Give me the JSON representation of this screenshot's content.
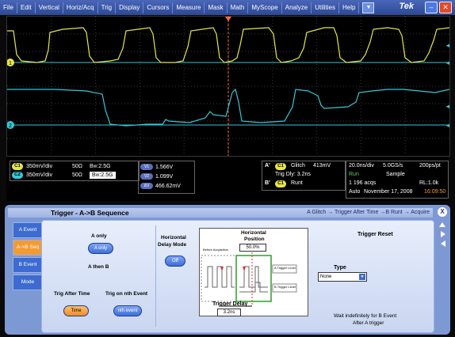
{
  "menu": [
    "File",
    "Edit",
    "Vertical",
    "Horiz/Acq",
    "Trig",
    "Display",
    "Cursors",
    "Measure",
    "Mask",
    "Math",
    "MyScope",
    "Analyze",
    "Utilities",
    "Help"
  ],
  "brand": "Tek",
  "window": {
    "minimize_icon": "minimize-icon",
    "close_icon": "close-icon"
  },
  "markers": {
    "ch1": "1",
    "ch2": "2",
    "trigger_arrow": "◄"
  },
  "channels": [
    {
      "tag": "C1",
      "scale": "350mV/div",
      "impedance": "50Ω",
      "bw": "B",
      "bw_sub": "W",
      "bw_val": ":2.5G",
      "color": "#e6e64a"
    },
    {
      "tag": "C2",
      "scale": "350mV/div",
      "impedance": "50Ω",
      "bw": "B",
      "bw_sub": "W",
      "bw_val": ":2.5G",
      "color": "#35c8d8"
    }
  ],
  "measurements": [
    {
      "tag": "V1",
      "value": "1.566V"
    },
    {
      "tag": "V2",
      "value": "1.099V"
    },
    {
      "tag": "ΔV",
      "value": "466.62mV"
    }
  ],
  "trigger_readout": {
    "a_tag": "A'",
    "source": "C1",
    "type": "Glitch",
    "level": "413mV",
    "delay": "Trig Dly: 3.2ns",
    "b_tag": "B'",
    "b_type": "Runt"
  },
  "acquisition": {
    "timebase": "20.0ns/div",
    "rate": "5.0GS/s",
    "pts": "200ps/pt",
    "state": "Run",
    "mode": "Sample",
    "acqs": "1 196 acqs",
    "rl": "RL:1.0k",
    "trig_mode": "Auto",
    "date": "November 17, 2008",
    "time": "16:09:50"
  },
  "panel": {
    "title": "Trigger - A->B Sequence",
    "sequence": "A Glitch → Trigger After Time →B Runt → Acquire",
    "close": "X",
    "tabs": [
      "A Event",
      "A->B Seq",
      "B Event",
      "Mode"
    ],
    "a_only_label": "A only",
    "a_only_button": "A only",
    "a_then_b": "A then B",
    "trig_after_time": "Trig After Time",
    "trig_on_nth": "Trig on nth Event",
    "time_button": "Time",
    "nth_button": "nth event",
    "hdelay_label_1": "Horizontal",
    "hdelay_label_2": "Delay Mode",
    "hdelay_button": "Off",
    "hpos_label_1": "Horizontal",
    "hpos_label_2": "Position",
    "hpos_value": "50.0%",
    "diag_before": "Before\nAcquisition",
    "diag_a_label": "A Trigger\nLevel",
    "diag_b_label": "B Trigger\nLevel",
    "trig_delay_label": "Trigger Delay",
    "trig_delay_value": "3.2ns",
    "trigger_reset": "Trigger Reset",
    "type_label": "Type",
    "type_value": "None",
    "wait_text_1": "Wait indefinitely for B Event",
    "wait_text_2": "After A trigger"
  }
}
